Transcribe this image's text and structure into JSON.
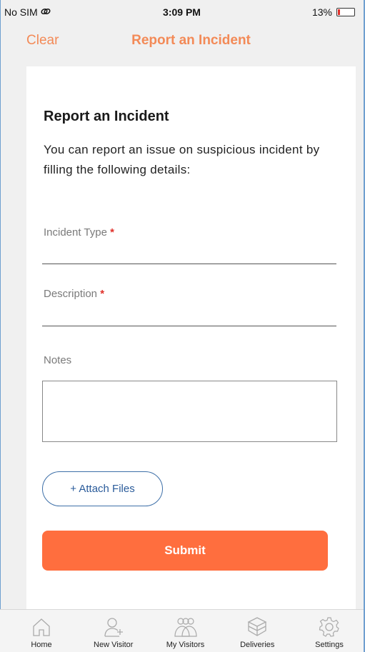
{
  "status_bar": {
    "carrier": "No SIM",
    "time": "3:09 PM",
    "battery_percent": "13%",
    "battery_level": 0.13
  },
  "nav": {
    "clear_label": "Clear",
    "title": "Report an Incident"
  },
  "form": {
    "heading": "Report an Incident",
    "description": "You can report an issue on suspicious incident by filling the following details:",
    "incident_type_label": "Incident Type",
    "description_label": "Description",
    "required_marker": "*",
    "notes_label": "Notes",
    "notes_value": "",
    "attach_label": "+ Attach Files",
    "submit_label": "Submit"
  },
  "tabs": [
    {
      "label": "Home",
      "icon": "home-icon"
    },
    {
      "label": "New Visitor",
      "icon": "add-user-icon"
    },
    {
      "label": "My Visitors",
      "icon": "group-icon"
    },
    {
      "label": "Deliveries",
      "icon": "box-icon"
    },
    {
      "label": "Settings",
      "icon": "gear-icon"
    }
  ],
  "colors": {
    "accent": "#f38a57",
    "submit": "#ff6e3e",
    "attach_border": "#3d6fa8",
    "required": "#e0302a"
  }
}
